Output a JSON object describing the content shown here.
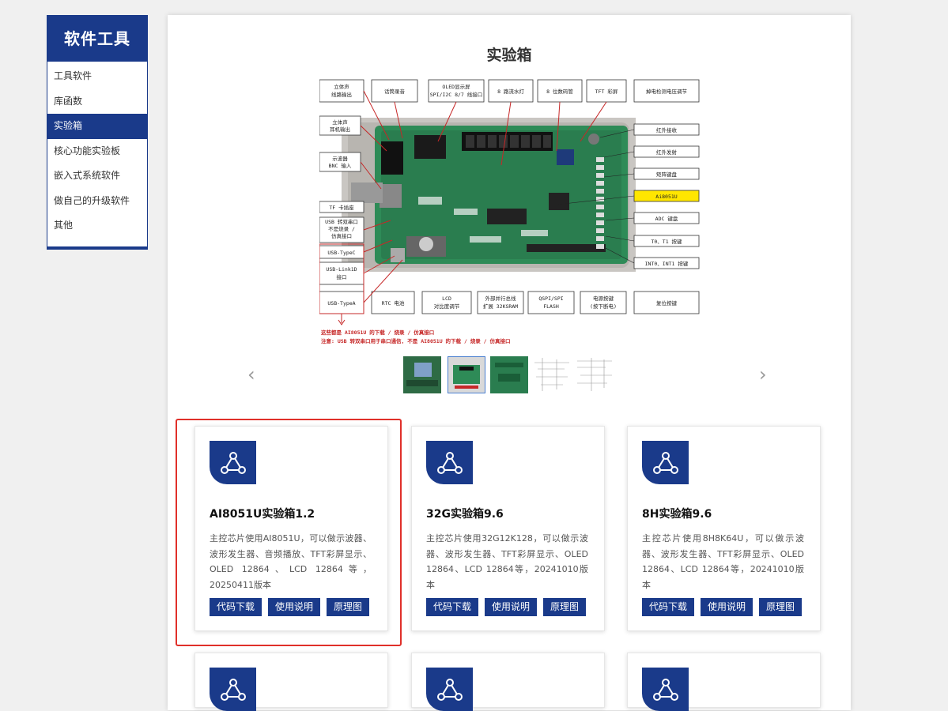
{
  "sidebar": {
    "title": "软件工具",
    "items": [
      {
        "label": "工具软件"
      },
      {
        "label": "库函数"
      },
      {
        "label": "实验箱"
      },
      {
        "label": "核心功能实验板"
      },
      {
        "label": "嵌入式系统软件"
      },
      {
        "label": "做自己的升级软件"
      },
      {
        "label": "其他"
      }
    ],
    "active_item": "实验箱"
  },
  "main": {
    "title": "实验箱",
    "board_labels": {
      "top": [
        "立体声\n线路输出",
        "话筒录音",
        "OLED显示屏\nSPI/I2C 8/7 线接口",
        "8 路流水灯",
        "8 位数码管",
        "TFT 彩屏",
        "掉电检测电压调节"
      ],
      "left": [
        "立体声\n耳机输出",
        "示波器\nBNC 输入",
        "TF 卡插座",
        "USB 转双串口\n不是烧录 /\n仿真接口",
        "USB-TypeC",
        "USB-Link1D\n接口",
        "USB-TypeA"
      ],
      "right": [
        "红外接收",
        "红外发射",
        "矩阵键盘",
        "Ai8051U",
        "ADC 键盘",
        "T0、T1 按键",
        "INT0、INT1 按键"
      ],
      "bottom": [
        "RTC 电池",
        "LCD\n对比度调节",
        "外部并行总线\n扩展 32KSRAM",
        "QSPI/SPI\nFLASH",
        "电源按键\n(按下断电)",
        "复位按键"
      ],
      "notes": [
        "这些都是 AI8051U 的下载 / 烧录 / 仿真接口",
        "注意: USB 转双串口用于串口通信, 不是 AI8051U 的下载 / 烧录 / 仿真接口"
      ]
    },
    "carousel": {
      "prev_icon": "chevron-left-icon",
      "next_icon": "chevron-right-icon",
      "thumbnail_count": 5,
      "selected_index": 1
    },
    "cards": [
      {
        "title": "AI8051U实验箱1.2",
        "desc": "主控芯片使用AI8051U，可以做示波器、波形发生器、音频播放、TFT彩屏显示、OLED 12864、LCD 12864等，20250411版本",
        "buttons": [
          "代码下载",
          "使用说明",
          "原理图"
        ]
      },
      {
        "title": "32G实验箱9.6",
        "desc": "主控芯片使用32G12K128，可以做示波器、波形发生器、TFT彩屏显示、OLED 12864、LCD 12864等，20241010版本",
        "buttons": [
          "代码下载",
          "使用说明",
          "原理图"
        ]
      },
      {
        "title": "8H实验箱9.6",
        "desc": "主控芯片使用8H8K64U，可以做示波器、波形发生器、TFT彩屏显示、OLED 12864、LCD 12864等，20241010版本",
        "buttons": [
          "代码下载",
          "使用说明",
          "原理图"
        ]
      }
    ]
  },
  "colors": {
    "brand": "#1a3a8a",
    "highlight": "#e0302a",
    "background": "#f0f0f0"
  }
}
